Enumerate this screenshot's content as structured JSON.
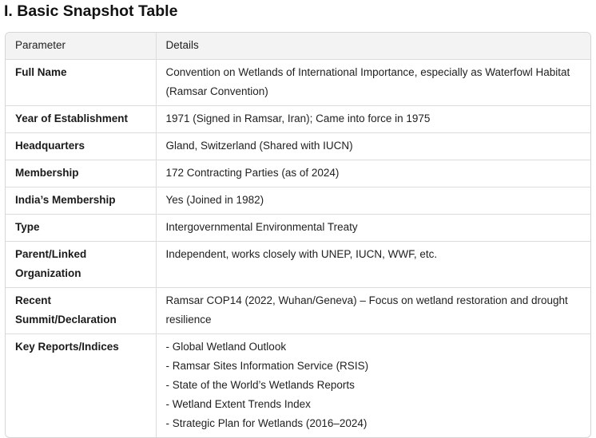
{
  "heading": "I. Basic Snapshot Table",
  "table": {
    "headers": [
      "Parameter",
      "Details"
    ],
    "rows": [
      {
        "param": "Full Name",
        "details": [
          "Convention on Wetlands of International Importance, especially as Waterfowl Habitat (Ramsar Convention)"
        ]
      },
      {
        "param": "Year of Establishment",
        "details": [
          "1971 (Signed in Ramsar, Iran); Came into force in 1975"
        ]
      },
      {
        "param": "Headquarters",
        "details": [
          "Gland, Switzerland (Shared with IUCN)"
        ]
      },
      {
        "param": "Membership",
        "details": [
          "172 Contracting Parties (as of 2024)"
        ]
      },
      {
        "param": "India’s Membership",
        "details": [
          "Yes (Joined in 1982)"
        ]
      },
      {
        "param": "Type",
        "details": [
          "Intergovernmental Environmental Treaty"
        ]
      },
      {
        "param": "Parent/Linked Organization",
        "details": [
          "Independent, works closely with UNEP, IUCN, WWF, etc."
        ]
      },
      {
        "param": "Recent Summit/Declaration",
        "details": [
          "Ramsar COP14 (2022, Wuhan/Geneva) – Focus on wetland restoration and drought resilience"
        ]
      },
      {
        "param": "Key Reports/Indices",
        "details": [
          "- Global Wetland Outlook",
          "- Ramsar Sites Information Service (RSIS)",
          "- State of the World’s Wetlands Reports",
          "- Wetland Extent Trends Index",
          "- Strategic Plan for Wetlands (2016–2024)"
        ]
      }
    ]
  }
}
